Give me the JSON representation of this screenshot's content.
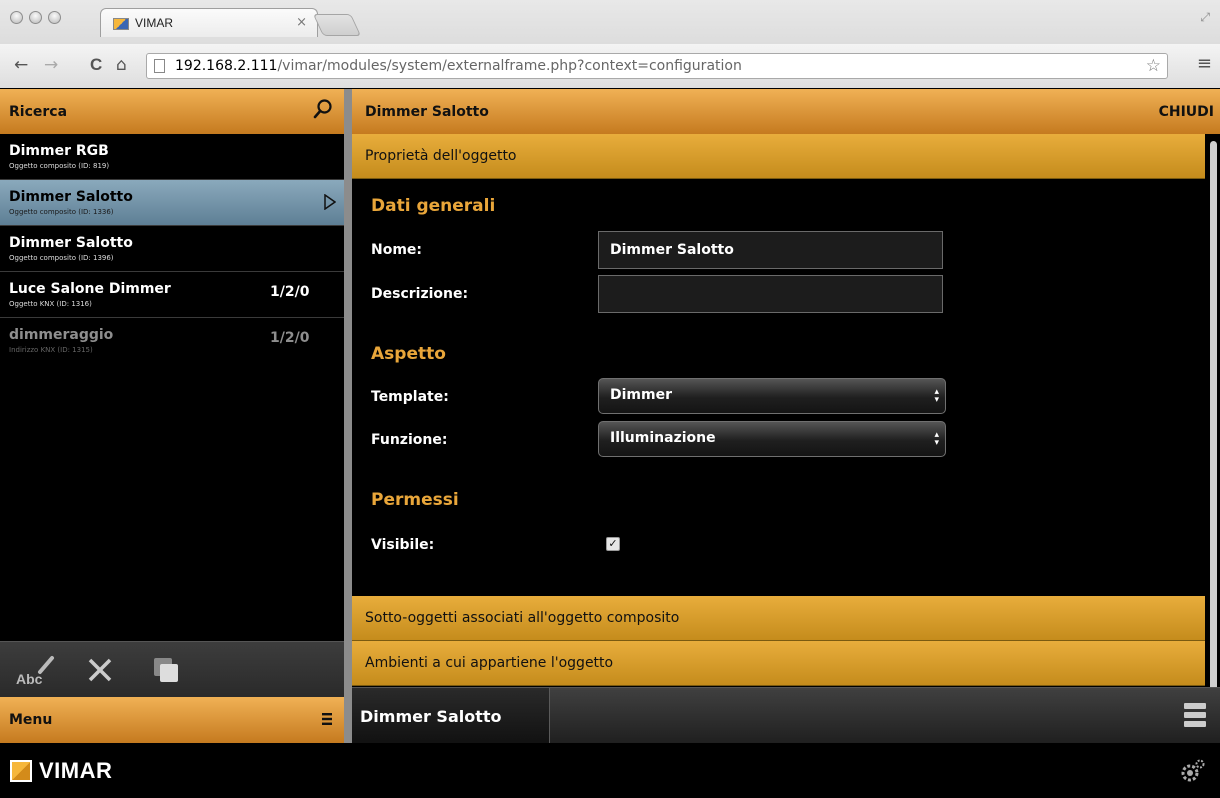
{
  "browser": {
    "tab_title": "VIMAR",
    "tab_close": "×",
    "url_host": "192.168.2.111",
    "url_path": "/vimar/modules/system/externalframe.php?context=configuration",
    "back": "←",
    "forward": "→",
    "reload": "C",
    "home": "⌂",
    "star": "☆",
    "menu": "≡"
  },
  "left_panel": {
    "search_label": "Ricerca",
    "items": [
      {
        "name": "Dimmer RGB",
        "sub": "Oggetto composito (ID: 819)",
        "addr": ""
      },
      {
        "name": "Dimmer Salotto",
        "sub": "Oggetto composito (ID: 1336)",
        "addr": ""
      },
      {
        "name": "Dimmer Salotto",
        "sub": "Oggetto composito (ID: 1396)",
        "addr": ""
      },
      {
        "name": "Luce Salone Dimmer",
        "sub": "Oggetto KNX (ID: 1316)",
        "addr": "1/2/0"
      },
      {
        "name": "dimmeraggio",
        "sub": "Indirizzo KNX (ID: 1315)",
        "addr": "1/2/0"
      }
    ],
    "selected_index": 1,
    "rename_label": "Abc",
    "menu_label": "Menu"
  },
  "right_panel": {
    "title": "Dimmer Salotto",
    "close_label": "CHIUDI",
    "sections": [
      {
        "label": "Proprietà dell'oggetto"
      },
      {
        "label": "Sotto-oggetti associati all'oggetto composito"
      },
      {
        "label": "Ambienti a cui appartiene l'oggetto"
      }
    ],
    "general": {
      "title": "Dati generali",
      "name_label": "Nome:",
      "name_value": "Dimmer Salotto",
      "desc_label": "Descrizione:",
      "desc_value": ""
    },
    "aspect": {
      "title": "Aspetto",
      "template_label": "Template:",
      "template_value": "Dimmer",
      "function_label": "Funzione:",
      "function_value": "Illuminazione"
    },
    "permissions": {
      "title": "Permessi",
      "visible_label": "Visibile:",
      "visible_checked": true
    },
    "bottom_current": "Dimmer Salotto"
  },
  "footer": {
    "logo_text": "VIMAR"
  },
  "colors": {
    "gold": "#e8ad3c",
    "selected_item": "#7896aa",
    "group_title": "#e9a63a"
  }
}
